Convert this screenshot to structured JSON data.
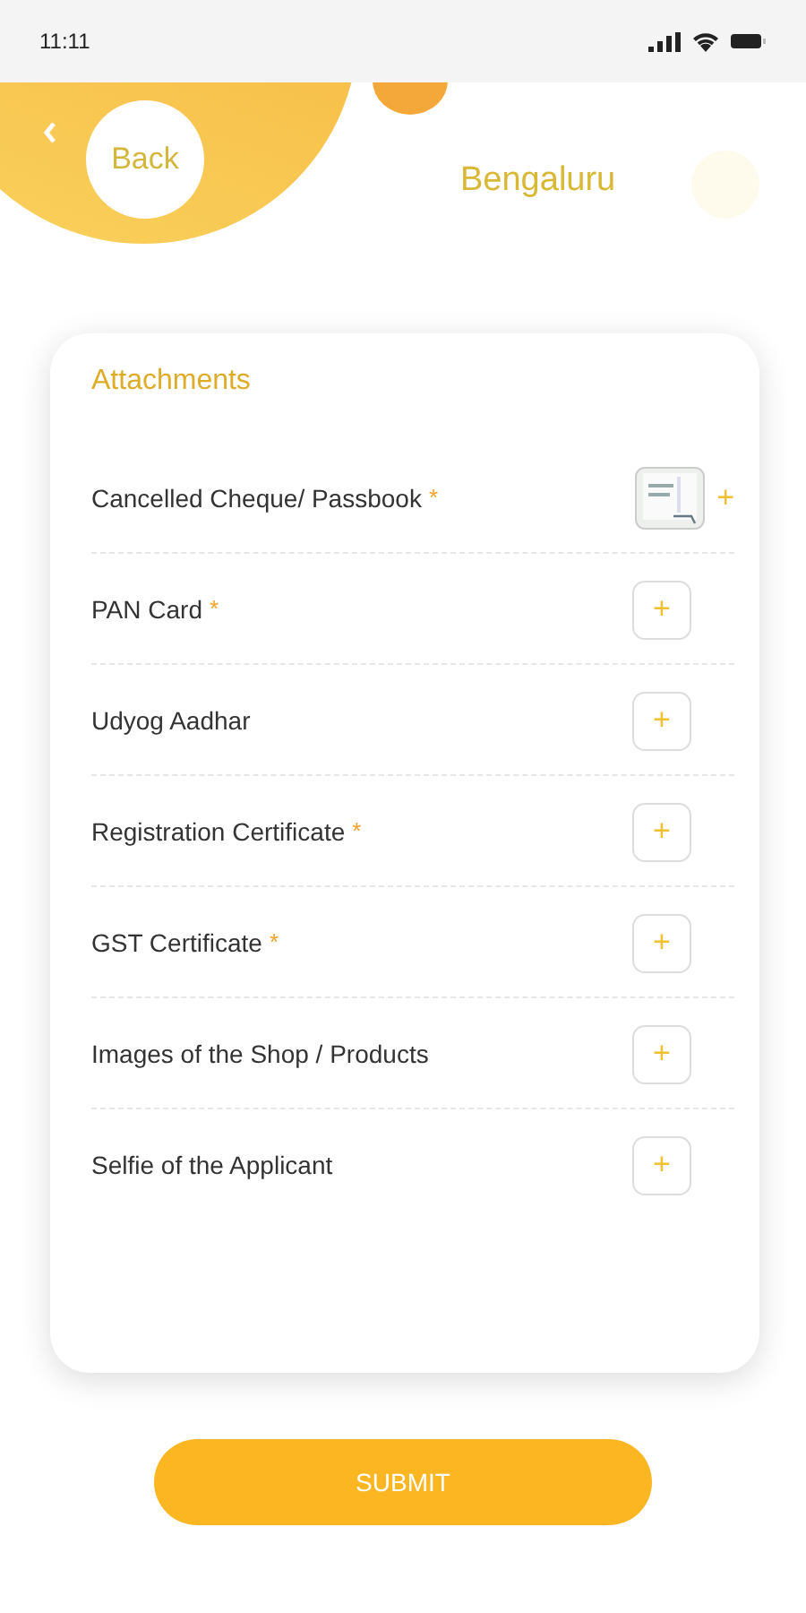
{
  "status_bar": {
    "time": "11:11"
  },
  "header": {
    "back": "Back",
    "city": "Bengaluru"
  },
  "card": {
    "title": "Attachments",
    "items": [
      {
        "label": "Cancelled Cheque/ Passbook",
        "required_mark": "*",
        "kind": "attached",
        "add": "+"
      },
      {
        "label": "PAN Card",
        "required_mark": "*",
        "kind": "empty",
        "add": "+"
      },
      {
        "label": "Udyog Aadhar",
        "kind": "empty",
        "add": "+"
      },
      {
        "label": "Registration Certificate",
        "required_mark": "*",
        "kind": "empty",
        "add": "+"
      },
      {
        "label": "GST Certificate",
        "required_mark": "*",
        "kind": "empty",
        "add": "+"
      },
      {
        "label": "Images of the Shop / Products",
        "kind": "empty",
        "add": "+"
      },
      {
        "label": "Selfie of the Applicant",
        "kind": "empty",
        "add": "+"
      }
    ]
  },
  "submit": "SUBMIT"
}
